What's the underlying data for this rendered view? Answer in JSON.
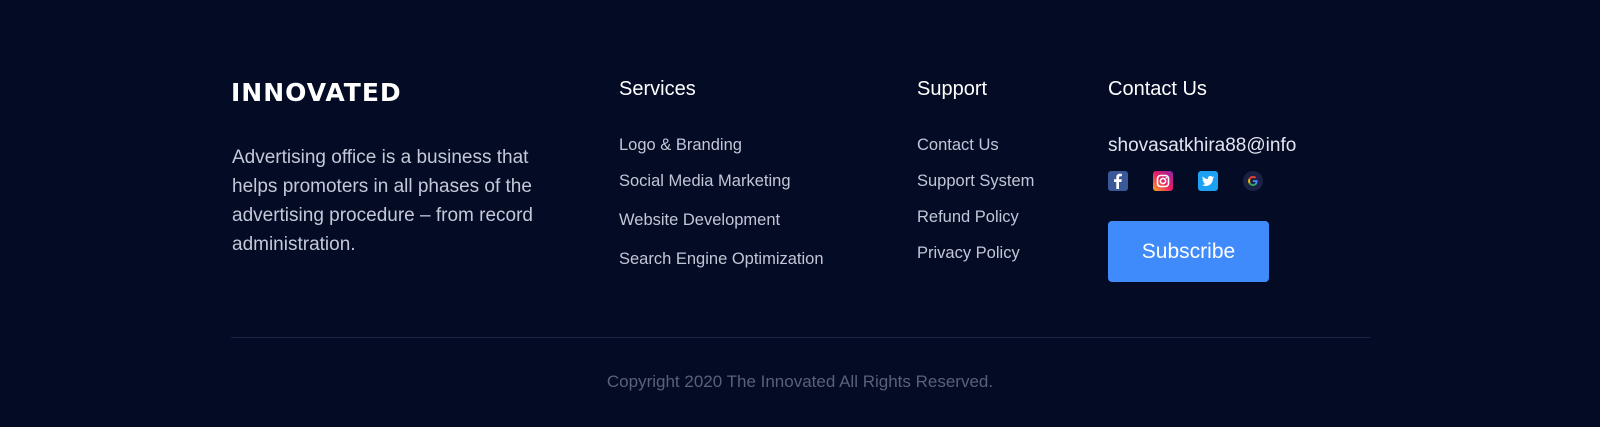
{
  "brand": {
    "name": "INNOVATED",
    "description": "Advertising office is a business that helps promoters in all phases of the advertising procedure – from record administration."
  },
  "services": {
    "title": "Services",
    "items": [
      "Logo & Branding",
      "Social Media Marketing",
      "Website Development",
      "Search Engine Optimization"
    ]
  },
  "support": {
    "title": "Support",
    "items": [
      "Contact Us",
      "Support System",
      "Refund Policy",
      "Privacy Policy"
    ]
  },
  "contact": {
    "title": "Contact Us",
    "email": "shovasatkhira88@info",
    "social": [
      "facebook-icon",
      "instagram-icon",
      "twitter-icon",
      "google-icon"
    ],
    "subscribe_label": "Subscribe"
  },
  "footer": {
    "copyright": "Copyright 2020 The Innovated All Rights Reserved."
  },
  "colors": {
    "background": "#040b25",
    "accent": "#3f8bfb",
    "divider": "#1e2540"
  }
}
